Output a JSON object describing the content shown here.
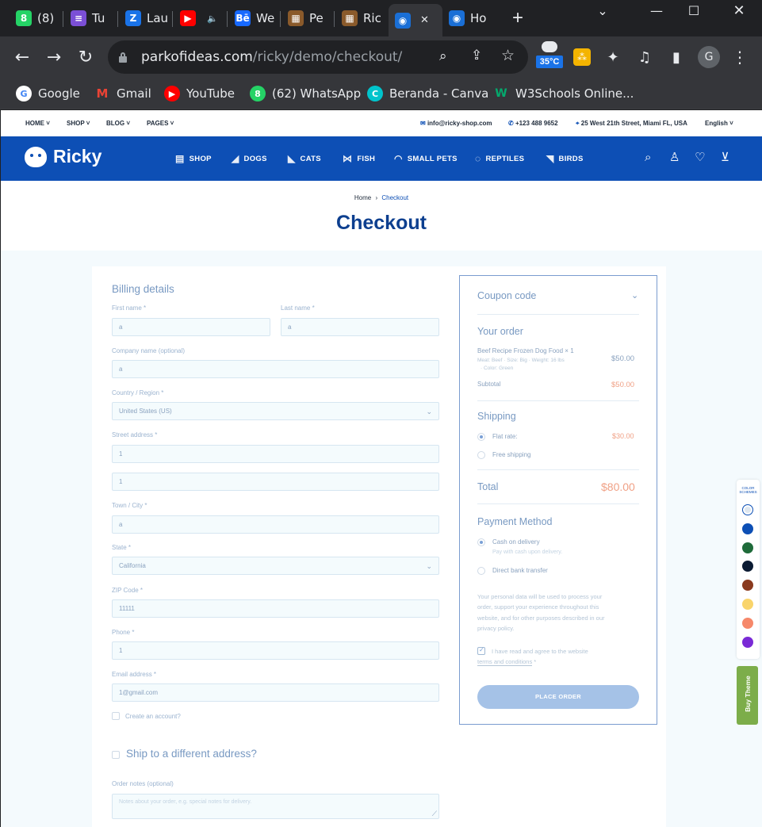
{
  "browser": {
    "tabs": [
      {
        "label": "(8)",
        "icon": "whatsapp-icon",
        "color": "#25d366",
        "glyph": "8"
      },
      {
        "label": "Tu",
        "icon": "list-icon",
        "color": "#7b4fd6",
        "glyph": "≡"
      },
      {
        "label": "Lau",
        "icon": "zalo-icon",
        "color": "#1a73e8",
        "glyph": "Z"
      },
      {
        "label": "",
        "icon": "youtube-icon",
        "color": "#ff0000",
        "glyph": "▶"
      },
      {
        "label": "We",
        "icon": "behance-icon",
        "color": "#1769ff",
        "glyph": "Bē"
      },
      {
        "label": "Pe",
        "icon": "pet-site-icon",
        "color": "#8a5a2b",
        "glyph": "▦"
      },
      {
        "label": "Ric",
        "icon": "pet-site-icon",
        "color": "#8a5a2b",
        "glyph": "▦"
      },
      {
        "label": "",
        "icon": "ricky-logo-icon",
        "color": "#1a6fd6",
        "glyph": "◉"
      },
      {
        "label": "Ho",
        "icon": "ricky-logo-icon",
        "color": "#1a6fd6",
        "glyph": "◉"
      }
    ],
    "new_tab": "+",
    "url_host": "parkofideas.com",
    "url_path": "/ricky/demo/checkout/",
    "weather": "35°C",
    "profile_initial": "G",
    "bookmarks": [
      {
        "label": "Google",
        "icon": "google-icon",
        "color": "#ffffff",
        "glyph": "G"
      },
      {
        "label": "Gmail",
        "icon": "gmail-icon",
        "color": "#ea4335",
        "glyph": "M"
      },
      {
        "label": "YouTube",
        "icon": "youtube-icon",
        "color": "#ff0000",
        "glyph": "▶"
      },
      {
        "label": "(62) WhatsApp",
        "icon": "whatsapp-icon",
        "color": "#25d366",
        "glyph": "8"
      },
      {
        "label": "Beranda - Canva",
        "icon": "canva-icon",
        "color": "#00c4cc",
        "glyph": "C"
      },
      {
        "label": "W3Schools Online...",
        "icon": "w3schools-icon",
        "color": "#04aa6d",
        "glyph": "W"
      }
    ]
  },
  "topbar": {
    "menu": [
      "HOME",
      "SHOP",
      "BLOG",
      "PAGES"
    ],
    "email": "info@ricky-shop.com",
    "phone": "+123 488 9652",
    "address": "25 West 21th Street, Miami FL, USA",
    "language": "English"
  },
  "nav": {
    "brand": "Ricky",
    "items": [
      "SHOP",
      "DOGS",
      "CATS",
      "FISH",
      "SMALL PETS",
      "REPTILES",
      "BIRDS"
    ]
  },
  "hero": {
    "breadcrumb_home": "Home",
    "breadcrumb_sep": "›",
    "breadcrumb_current": "Checkout",
    "title": "Checkout"
  },
  "billing": {
    "heading": "Billing details",
    "first_name_label": "First name *",
    "first_name_value": "a",
    "last_name_label": "Last name *",
    "last_name_value": "a",
    "company_label": "Company name (optional)",
    "company_value": "a",
    "country_label": "Country / Region *",
    "country_value": "United States (US)",
    "street_label": "Street address *",
    "street_value": "1",
    "street2_value": "1",
    "city_label": "Town / City *",
    "city_value": "a",
    "state_label": "State *",
    "state_value": "California",
    "zip_label": "ZIP Code *",
    "zip_value": "11111",
    "phone_label": "Phone *",
    "phone_value": "1",
    "email_label": "Email address *",
    "email_value": "1@gmail.com",
    "create_account": "Create an account?",
    "ship_different": "Ship to a different address?",
    "notes_label": "Order notes (optional)",
    "notes_placeholder": "Notes about your order, e.g. special notes for delivery."
  },
  "order": {
    "coupon": "Coupon code",
    "your_order": "Your order",
    "product_name": "Beef Recipe Frozen Dog Food",
    "product_qty": "× 1",
    "product_meta_1": "Meat: Beef  ·  Size: Big  ·  Weight: 16 lbs",
    "product_meta_2": "·  Color: Green",
    "product_price": "$50.00",
    "subtotal_label": "Subtotal",
    "subtotal_value": "$50.00",
    "shipping_heading": "Shipping",
    "flat_rate": "Flat rate:",
    "flat_rate_value": "$30.00",
    "free_shipping": "Free shipping",
    "total_label": "Total",
    "total_value": "$80.00",
    "payment_heading": "Payment Method",
    "cod": "Cash on delivery",
    "cod_note": "Pay with cash upon delivery.",
    "bank": "Direct bank transfer",
    "privacy_1": "Your personal data will be used to process your",
    "privacy_2": "order, support your experience throughout this",
    "privacy_3": "website, and for other purposes described in our",
    "privacy_4": "privacy policy.",
    "agree_1": "I have read and agree to the website",
    "agree_2": "terms and conditions",
    "agree_star": "*",
    "place_order": "PLACE ORDER"
  },
  "side": {
    "color_schemes_1": "COLOR",
    "color_schemes_2": "SCHEMES",
    "swatches": [
      "#dfe7ef",
      "#0d4fb5",
      "#1f6b3a",
      "#0b1b33",
      "#8a3a1e",
      "#f9d46b",
      "#f6886a",
      "#7a2ad6"
    ],
    "buy_theme": "Buy Theme",
    "buy_color": "#7cad4a"
  }
}
